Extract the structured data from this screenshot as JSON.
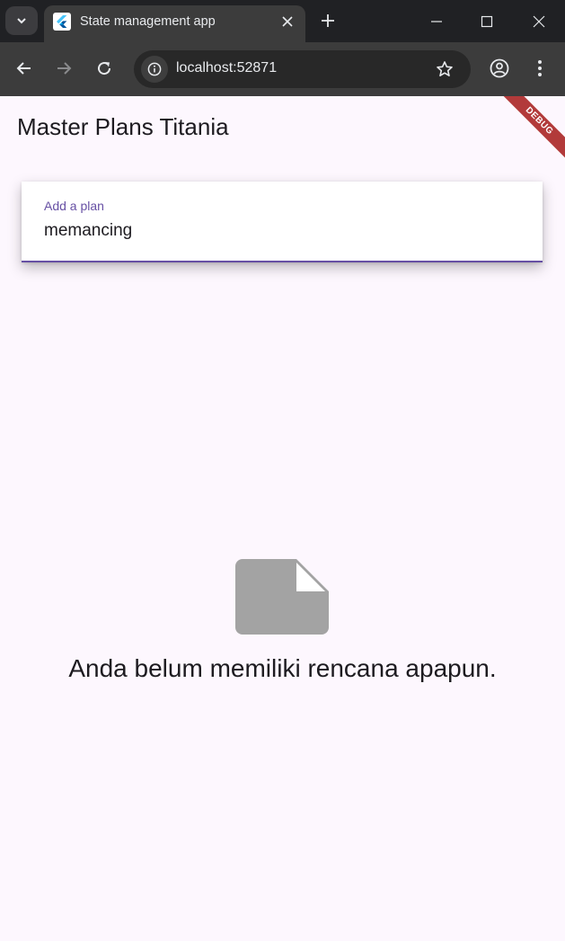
{
  "browser": {
    "tab": {
      "title": "State management app"
    },
    "url": "localhost:52871"
  },
  "app": {
    "title": "Master Plans Titania",
    "debug_banner": "DEBUG",
    "input": {
      "label": "Add a plan",
      "value": "memancing"
    },
    "empty_state": {
      "icon": "note-icon",
      "message": "Anda belum memiliki rencana apapun."
    }
  },
  "colors": {
    "browser_dark": "#202124",
    "toolbar": "#3c3c3c",
    "app_background": "#fdf7fe",
    "accent": "#6750a4",
    "debug_banner": "#b23a3a",
    "empty_icon": "#a3a3a3"
  }
}
